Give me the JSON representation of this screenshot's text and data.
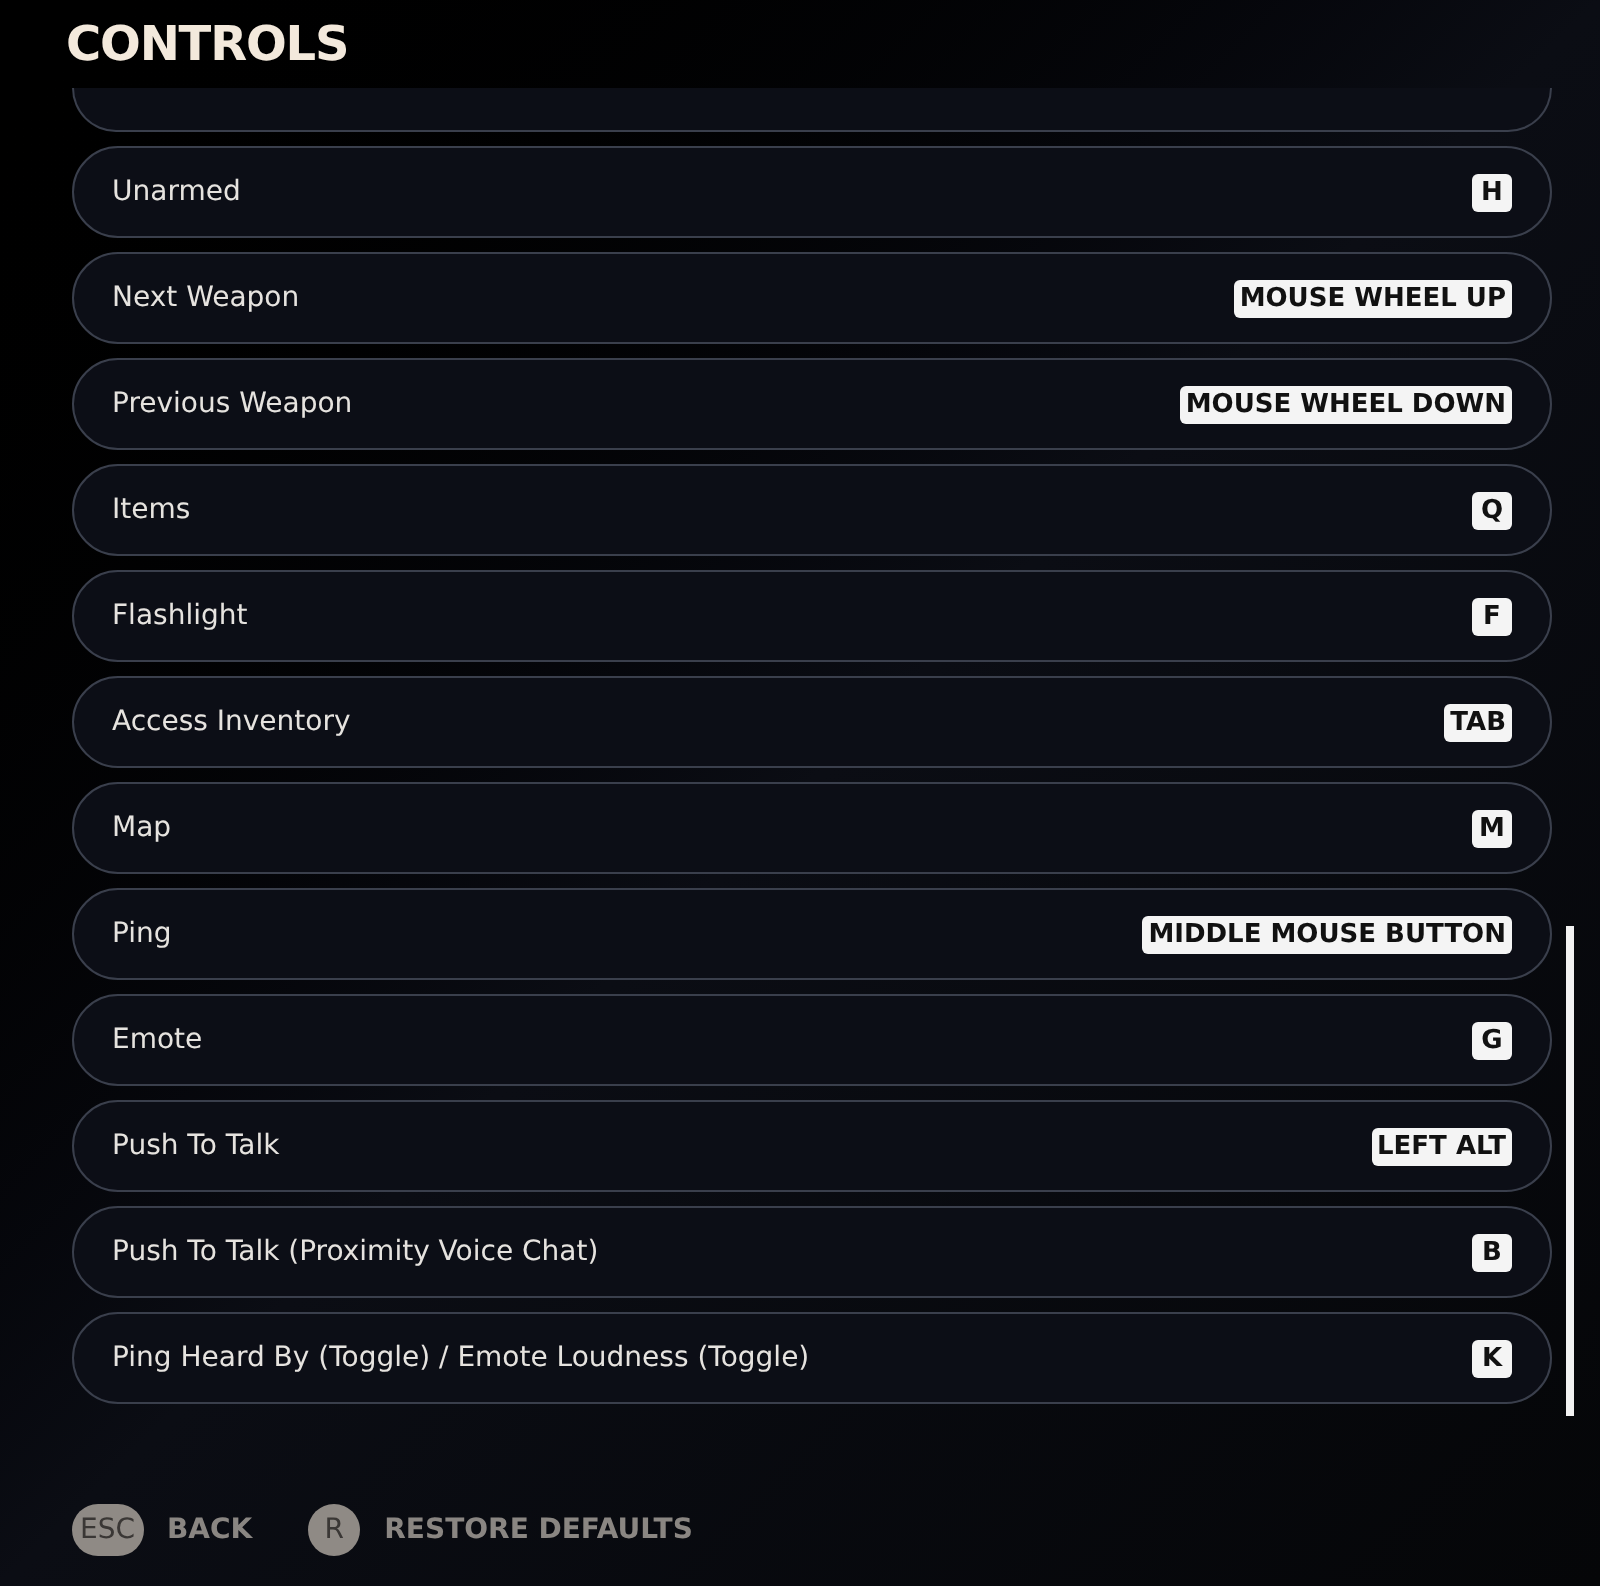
{
  "title": "CONTROLS",
  "bindings": [
    {
      "action": "Unarmed",
      "key": "H"
    },
    {
      "action": "Next Weapon",
      "key": "MOUSE WHEEL UP"
    },
    {
      "action": "Previous Weapon",
      "key": "MOUSE WHEEL DOWN"
    },
    {
      "action": "Items",
      "key": "Q"
    },
    {
      "action": "Flashlight",
      "key": "F"
    },
    {
      "action": "Access Inventory",
      "key": "TAB"
    },
    {
      "action": "Map",
      "key": "M"
    },
    {
      "action": "Ping",
      "key": "MIDDLE MOUSE BUTTON"
    },
    {
      "action": "Emote",
      "key": "G"
    },
    {
      "action": "Push To Talk",
      "key": "LEFT ALT"
    },
    {
      "action": "Push To Talk (Proximity Voice Chat)",
      "key": "B"
    },
    {
      "action": "Ping Heard By (Toggle) / Emote Loudness (Toggle)",
      "key": "K"
    }
  ],
  "footer": [
    {
      "key": "ESC",
      "label": "BACK",
      "kind": "pill"
    },
    {
      "key": "R",
      "label": "RESTORE DEFAULTS",
      "kind": "circle"
    }
  ]
}
